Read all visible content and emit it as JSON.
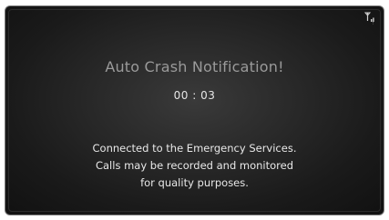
{
  "status_bar": {
    "icon": "antenna-signal-icon"
  },
  "notification": {
    "title": "Auto Crash Notification!",
    "timer": "00 : 03",
    "message_lines": [
      "Connected to the Emergency Services.",
      "Calls may be recorded and monitored",
      "for quality purposes."
    ]
  },
  "colors": {
    "background": "#1a1a1a",
    "title_text": "#9a9a9a",
    "body_text": "#e8e8e8",
    "frame_border": "#7a7a7a"
  }
}
